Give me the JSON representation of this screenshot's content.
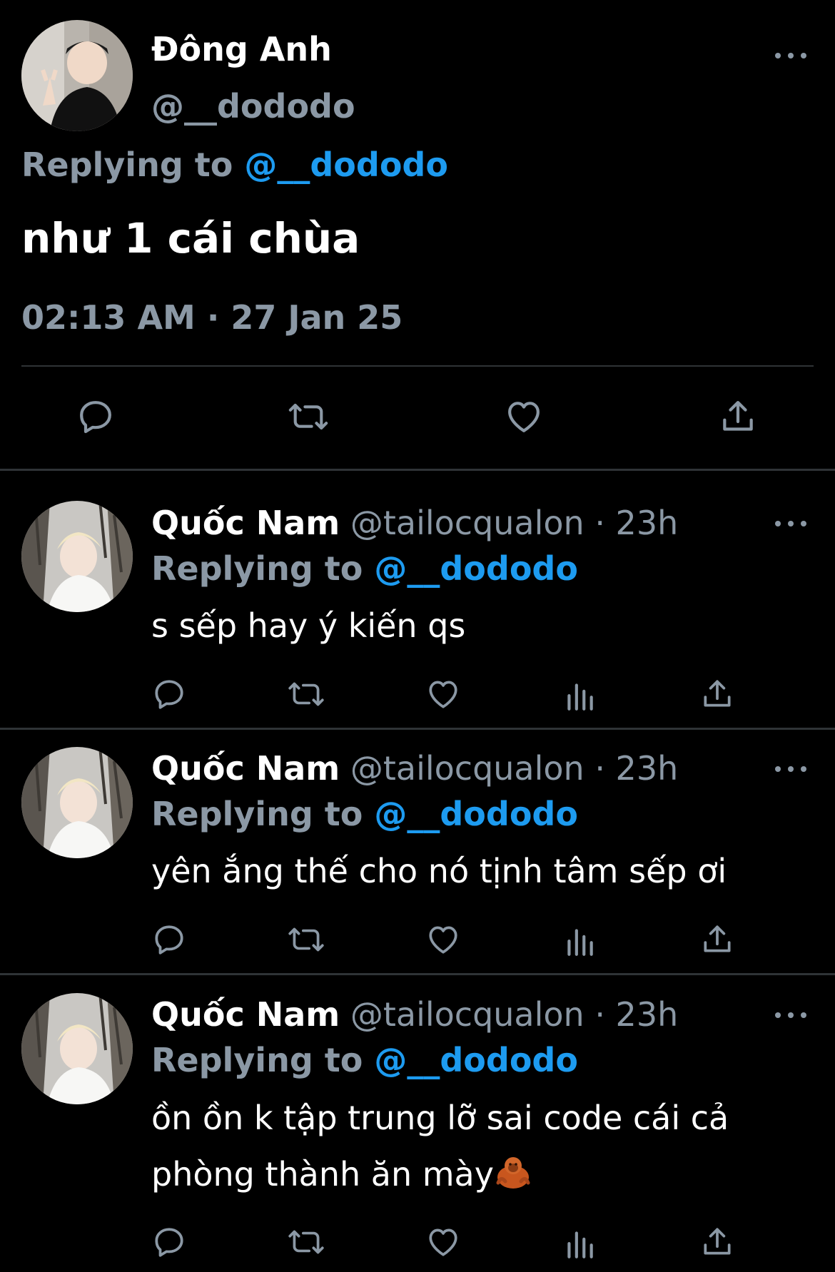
{
  "main_tweet": {
    "author_name": "Đông Anh",
    "handle": "@__dododo",
    "replying_label": "Replying to",
    "replying_handle": "@__dododo",
    "text": "như 1 cái chùa",
    "timestamp": "02:13 AM · 27 Jan 25"
  },
  "replies": [
    {
      "author_name": "Quốc Nam",
      "handle": "@tailocqualon",
      "time": "· 23h",
      "replying_label": "Replying to",
      "replying_handle": "@__dododo",
      "lines": [
        "s sếp hay ý kiến qs"
      ]
    },
    {
      "author_name": "Quốc Nam",
      "handle": "@tailocqualon",
      "time": "· 23h",
      "replying_label": "Replying to",
      "replying_handle": "@__dododo",
      "lines": [
        "yên ắng thế cho nó tịnh tâm sếp ơi"
      ]
    },
    {
      "author_name": "Quốc Nam",
      "handle": "@tailocqualon",
      "time": "· 23h",
      "replying_label": "Replying to",
      "replying_handle": "@__dododo",
      "lines": [
        "ồn ồn k tập trung lỡ sai code cái cả",
        "phòng thành ăn mày"
      ]
    }
  ],
  "icons": {
    "reply": "reply-icon",
    "retweet": "retweet-icon",
    "like": "heart-icon",
    "views": "analytics-icon",
    "share": "share-icon",
    "more": "more-icon",
    "emoji": "orangutan-emoji"
  },
  "colors": {
    "background": "#000000",
    "text": "#ffffff",
    "muted": "#8b98a5",
    "link": "#1d9bf0",
    "divider": "#2f3336"
  }
}
